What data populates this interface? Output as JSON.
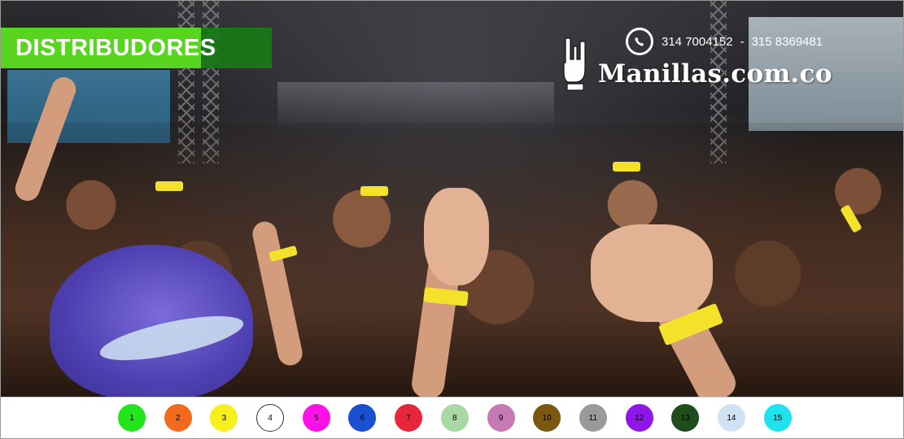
{
  "banner": {
    "label": "DISTRIBUDORES"
  },
  "contact": {
    "phone1": "314 7004152",
    "separator": "-",
    "phone2": "315 8369481",
    "icon": "whatsapp-icon"
  },
  "brand": {
    "name": "Manillas.com.co",
    "icon": "rock-hand-icon"
  },
  "colors": [
    {
      "label": "1",
      "color": "#22e51b",
      "border": "#22e51b"
    },
    {
      "label": "2",
      "color": "#f26b1d",
      "border": "#f26b1d"
    },
    {
      "label": "3",
      "color": "#f7ef1e",
      "border": "#f7ef1e"
    },
    {
      "label": "4",
      "color": "#ffffff",
      "border": "#333333"
    },
    {
      "label": "5",
      "color": "#ff12e8",
      "border": "#ff12e8"
    },
    {
      "label": "6",
      "color": "#1b4fd1",
      "border": "#1b4fd1"
    },
    {
      "label": "7",
      "color": "#e8263a",
      "border": "#e8263a"
    },
    {
      "label": "8",
      "color": "#a8d9a4",
      "border": "#a8d9a4"
    },
    {
      "label": "9",
      "color": "#c57ab4",
      "border": "#c57ab4"
    },
    {
      "label": "10",
      "color": "#7a5810",
      "border": "#7a5810"
    },
    {
      "label": "11",
      "color": "#9a9a9a",
      "border": "#9a9a9a"
    },
    {
      "label": "12",
      "color": "#8e16e8",
      "border": "#8e16e8"
    },
    {
      "label": "13",
      "color": "#1f4d1c",
      "border": "#1f4d1c"
    },
    {
      "label": "14",
      "color": "#cfe2f3",
      "border": "#cfe2f3"
    },
    {
      "label": "15",
      "color": "#1ee3ef",
      "border": "#1ee3ef"
    }
  ]
}
